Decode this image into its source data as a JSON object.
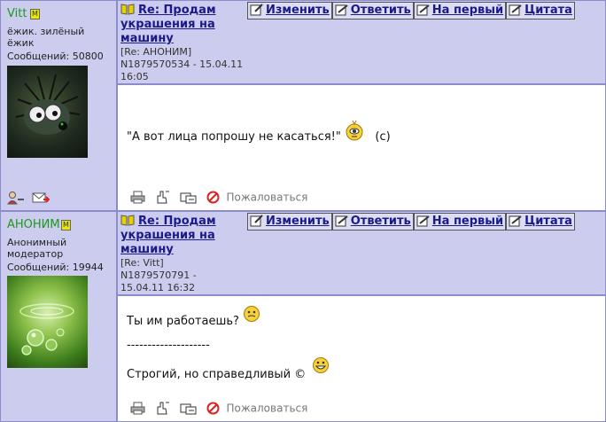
{
  "posts": [
    {
      "username": "Vitt",
      "mod_badge": "M",
      "user_title": "ёжик. зилёный ёжик",
      "messages_label": "Сообщений: 50800",
      "subject": "Re: Продам украшения на машину",
      "meta": "[Re: АНОНИМ]  N1879570534 - 15.04.11 16:05",
      "body_line1": "\"А вот лица попрошу не касаться!\"",
      "body_suffix": "(с)",
      "report_label": "Пожаловаться"
    },
    {
      "username": "АНОНИМ",
      "mod_badge": "M",
      "user_title": "Анонимный модератор",
      "messages_label": "Сообщений: 19944",
      "subject": "Re: Продам украшения на машину",
      "meta": "[Re: Vitt]  N1879570791 - 15.04.11 16:32",
      "body_line1": "Ты им работаешь?",
      "body_sep": "--------------------",
      "body_line3": "Строгий, но справедливый ©",
      "report_label": "Пожаловаться"
    }
  ],
  "buttons": {
    "edit": "Изменить",
    "reply": "Ответить",
    "top": "На первый",
    "quote": "Цитата"
  },
  "colors": {
    "header_bg": "#ccccee",
    "border": "#8c8ccc",
    "link": "#1a1a88",
    "username": "#1a9a1a"
  },
  "icons": [
    "book-icon",
    "edit-icon",
    "reply-icon",
    "top-icon",
    "quote-icon",
    "print-icon",
    "notify-icon",
    "forward-icon",
    "report-icon",
    "profile-icon",
    "mail-icon",
    "smiley-icon"
  ]
}
